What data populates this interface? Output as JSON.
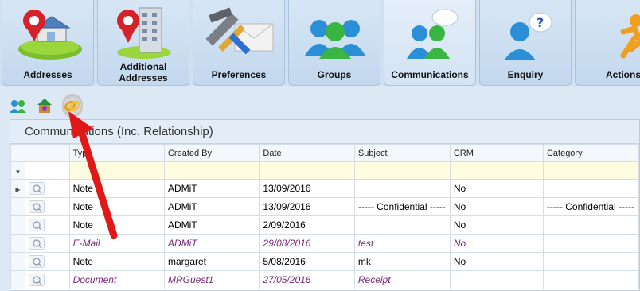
{
  "tabs": [
    {
      "label": "Addresses"
    },
    {
      "label": "Additional Addresses"
    },
    {
      "label": "Preferences"
    },
    {
      "label": "Groups"
    },
    {
      "label": "Communications"
    },
    {
      "label": "Enquiry"
    },
    {
      "label": "Actions"
    }
  ],
  "toolbar": {
    "buttons": [
      "people-icon",
      "house-people-icon",
      "link-icon"
    ]
  },
  "grid": {
    "title": "Communications (Inc. Relationship)",
    "columns": [
      "Type",
      "Created By",
      "Date",
      "Subject",
      "CRM",
      "Category"
    ],
    "rows": [
      {
        "type": "Note",
        "created_by": "ADMiT",
        "date": "13/09/2016",
        "subject": "",
        "crm": "No",
        "category": ""
      },
      {
        "type": "Note",
        "created_by": "ADMiT",
        "date": "13/09/2016",
        "subject": "----- Confidential -----",
        "crm": "No",
        "category": "----- Confidential -----"
      },
      {
        "type": "Note",
        "created_by": "ADMiT",
        "date": "2/09/2016",
        "subject": "",
        "crm": "No",
        "category": ""
      },
      {
        "type": "E-Mail",
        "created_by": "ADMiT",
        "date": "29/08/2016",
        "subject": "test",
        "crm": "No",
        "category": ""
      },
      {
        "type": "Note",
        "created_by": "margaret",
        "date": "5/08/2016",
        "subject": "mk",
        "crm": "No",
        "category": ""
      },
      {
        "type": "Document",
        "created_by": "MRGuest1",
        "date": "27/05/2016",
        "subject": "Receipt",
        "crm": "",
        "category": ""
      }
    ]
  },
  "colors": {
    "accent_arrow": "#e01818",
    "italic_row_text": "#7a2a7a"
  }
}
